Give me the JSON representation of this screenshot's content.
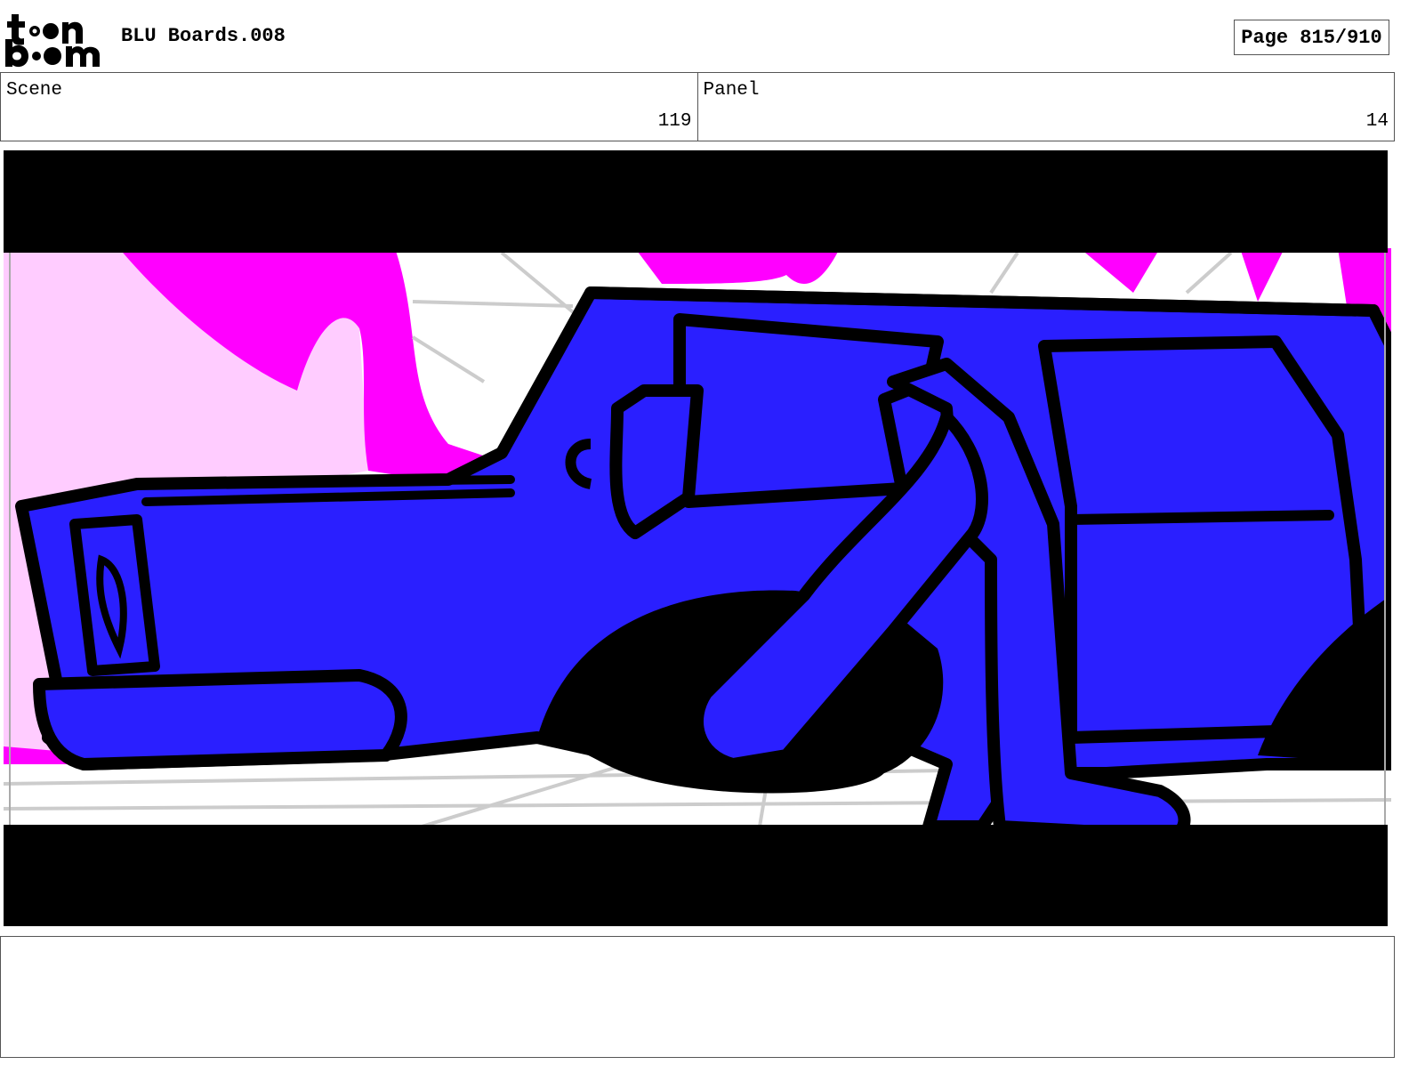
{
  "header": {
    "logo_text": "toon boom",
    "project_title": "BLU Boards.008",
    "page_label": "Page 815/910"
  },
  "info": {
    "scene_label": "Scene",
    "scene_value": "119",
    "panel_label": "Panel",
    "panel_value": "14"
  },
  "frame": {
    "description_colors": {
      "car": "#2a1fff",
      "outline": "#000000",
      "background_magenta": "#ff00ff",
      "background_pink": "#ffccff",
      "guides": "#cccccc"
    }
  },
  "notes": {
    "text": ""
  }
}
